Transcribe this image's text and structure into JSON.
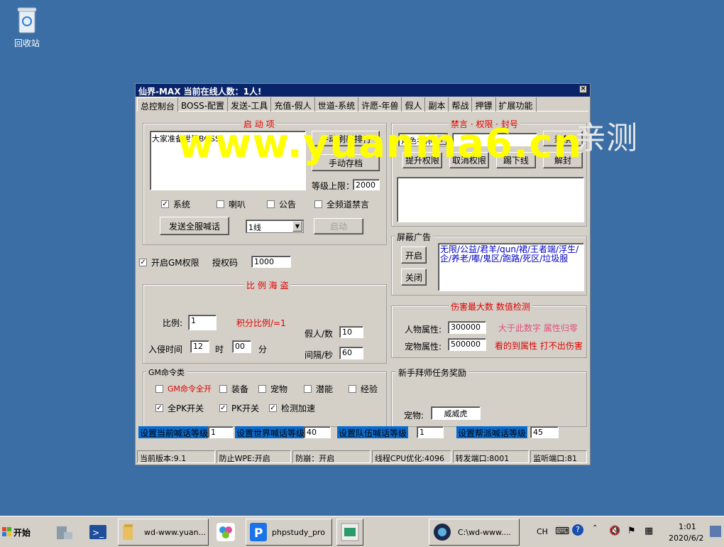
{
  "desktop": {
    "recycle_bin_label": "回收站"
  },
  "watermark": {
    "url_text": "www.yuanma6.cn",
    "tag_text": "亲测"
  },
  "window": {
    "title": "仙界-MAX   当前在线人数：1人!",
    "close_glyph": "×",
    "tabs": [
      "总控制台",
      "BOSS-配置",
      "发送-工具",
      "充值-假人",
      "世道-系统",
      "许愿-年兽",
      "假人",
      "副本",
      "帮战",
      "押镖",
      "扩展功能"
    ],
    "startup": {
      "title": "启 动 项",
      "textarea_value": "大家准备世界BOSS",
      "manual_refresh_btn": "手动刷新排行",
      "manual_save_btn": "手动存档",
      "level_cap_label": "等级上限：",
      "level_cap_value": "2000",
      "checks": [
        {
          "label": "系统",
          "checked": "✓"
        },
        {
          "label": "喇叭",
          "checked": ""
        },
        {
          "label": "公告",
          "checked": ""
        },
        {
          "label": "全频道禁言",
          "checked": ""
        }
      ],
      "send_all_btn": "发送全服喊话",
      "line_select": "1线",
      "launch_btn": "启动"
    },
    "gm": {
      "enable_label": "开启GM权限",
      "enable_checked": "✓",
      "auth_label": "授权码",
      "auth_value": "1000"
    },
    "ratio": {
      "title": "比 例  海 盗",
      "ratio_label": "比例:",
      "ratio_value": "1",
      "points_label": "积分比例/=1",
      "fake_label": "假人/数",
      "fake_value": "10",
      "invade_label": "入侵时间",
      "hour_value": "12",
      "hour_unit": "时",
      "minute_value": "00",
      "minute_unit": "分",
      "interval_label": "间隔/秒",
      "interval_value": "60"
    },
    "gm_cmds": {
      "title": "GM命令类",
      "items": [
        {
          "label": "GM命令全开",
          "checked": ""
        },
        {
          "label": "装备",
          "checked": ""
        },
        {
          "label": "宠物",
          "checked": ""
        },
        {
          "label": "潜能",
          "checked": ""
        },
        {
          "label": "经验",
          "checked": ""
        },
        {
          "label": "全PK开关",
          "checked": "✓"
        },
        {
          "label": "PK开关",
          "checked": "✓"
        },
        {
          "label": "检测加速",
          "checked": "✓"
        }
      ]
    },
    "ban": {
      "title": "禁言 · 权限 · 封号",
      "select_value": "角色名称",
      "ban_btn": "封禁",
      "buttons": [
        "提升权限",
        "取消权限",
        "踢下线",
        "解封"
      ]
    },
    "ads": {
      "title": "屏蔽广告",
      "open_btn": "开启",
      "close_btn": "关闭",
      "words": "无限/公益/君羊/qun/裙/王者端/浮生/企/养老/嘟/鬼区/跑路/死区/垃圾服"
    },
    "damage": {
      "title": "伤害最大数 数值检测",
      "char_label": "人物属性:",
      "char_value": "300000",
      "pet_label": "宠物属性:",
      "pet_value": "500000",
      "hint1": "大于此数字 属性归零",
      "hint2": "看的到属性 打不出伤害"
    },
    "newbie": {
      "title": "新手拜师任务奖励",
      "pet_label": "宠物:",
      "pet_value": "威威虎"
    },
    "chat_levels": [
      {
        "label": "设置当前喊话等级",
        "value": "1"
      },
      {
        "label": "设置世界喊话等级",
        "value": "40"
      },
      {
        "label": "设置队伍喊话等级",
        "value": "1"
      },
      {
        "label": "设置帮派喊话等级",
        "value": "45"
      }
    ],
    "status": [
      "当前版本:9.1",
      "防止WPE:开启",
      "防崩：开启",
      "线程CPU优化:4096",
      "转发端口:8001",
      "监听端口:81"
    ]
  },
  "taskbar": {
    "start_label": "开始",
    "tasks": [
      "wd-www.yuan...",
      "phpstudy_pro",
      "C:\\wd-www...."
    ],
    "lang": "CH",
    "time": "1:01",
    "date": "2020/6/2"
  }
}
